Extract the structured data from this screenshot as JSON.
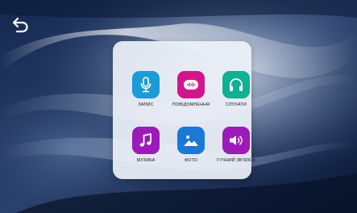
{
  "colors": {
    "record": "#1b9bd8",
    "messages": "#d3158c",
    "listen": "#10b095",
    "music": "#9b1ab8",
    "photo": "#1a78d6",
    "speaker": "#9b1ab8"
  },
  "tiles": [
    {
      "label": "ЗАПИС",
      "icon": "microphone-icon"
    },
    {
      "label": "ПОВІДОМЛЕННЯ",
      "icon": "voicemail-icon"
    },
    {
      "label": "СЛУХАТИ",
      "icon": "headphones-icon"
    },
    {
      "label": "МУЗИКА",
      "icon": "music-note-icon"
    },
    {
      "label": "ФОТО",
      "icon": "photo-icon"
    },
    {
      "label": "ГУЧНИЙ ЗВ'ЯЗОК",
      "icon": "speaker-icon"
    }
  ],
  "back": {
    "icon": "back-arrow-icon"
  }
}
